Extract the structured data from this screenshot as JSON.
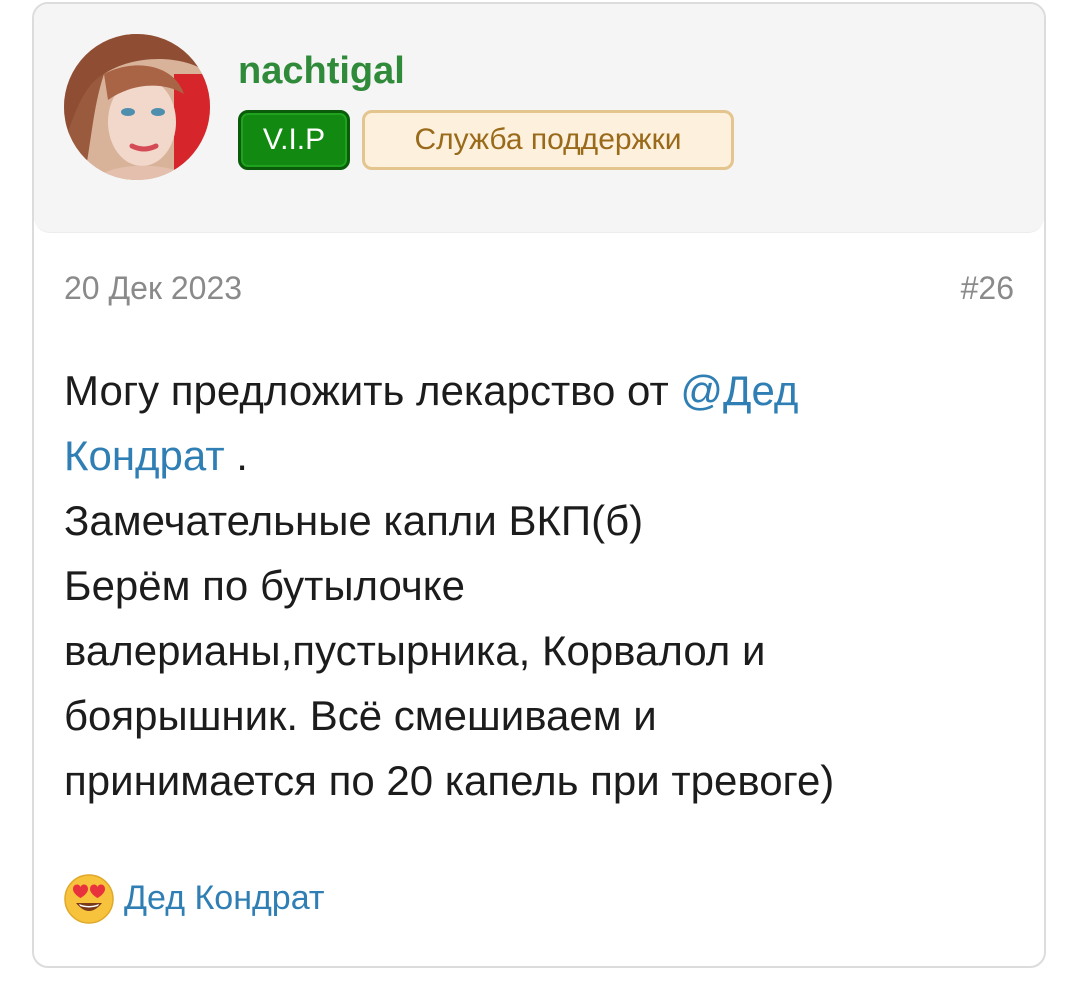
{
  "post": {
    "author": {
      "name": "nachtigal",
      "badges": [
        "V.I.P",
        "Служба поддержки"
      ]
    },
    "date": "20 Дек 2023",
    "number": "#26",
    "body": {
      "line1_text": "Могу предложить лекарство от ",
      "mention_part1": "@Дед",
      "mention_part2": "Кондрат",
      "line2_after": " .",
      "line3": "Замечательные капли ВКП(б)",
      "line4": "Берём по бутылочке",
      "line5": "валерианы,пустырника, Корвалол и",
      "line6": "боярышник. Всё смешиваем и",
      "line7": "принимается по 20 капель при тревоге)"
    },
    "reactions": {
      "icon": "heart-eyes-emoji-icon",
      "users": "Дед Кондрат"
    }
  },
  "colors": {
    "username": "#2f8a3a",
    "vip_badge": "#128a12",
    "support_badge_bg": "#fdf0dc",
    "support_badge_text": "#9a6a1b",
    "link": "#2f7fb5",
    "meta": "#8a8a8a"
  }
}
